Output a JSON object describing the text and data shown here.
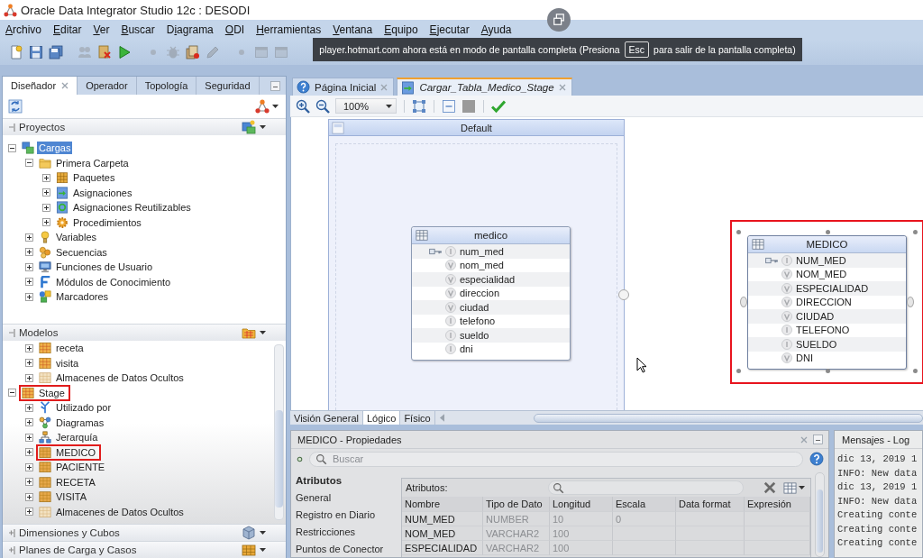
{
  "window": {
    "title": "Oracle Data Integrator Studio 12c : DESODI"
  },
  "menu": [
    {
      "mnemonic": "A",
      "rest": "rchivo"
    },
    {
      "mnemonic": "E",
      "rest": "ditar"
    },
    {
      "mnemonic": "V",
      "rest": "er"
    },
    {
      "mnemonic": "B",
      "rest": "uscar"
    },
    {
      "lead": "D",
      "mnemonic": "i",
      "rest": "agrama"
    },
    {
      "mnemonic": "O",
      "rest": "DI"
    },
    {
      "mnemonic": "H",
      "rest": "erramientas"
    },
    {
      "mnemonic": "V",
      "rest": "entana"
    },
    {
      "mnemonic": "E",
      "rest": "quipo"
    },
    {
      "mnemonic": "E",
      "rest": "jecutar"
    },
    {
      "mnemonic": "A",
      "rest": "yuda"
    }
  ],
  "toolbar": [
    {
      "buttons": [
        {
          "kind": "new",
          "disabled": false
        },
        {
          "kind": "save",
          "disabled": false
        },
        {
          "kind": "save-all",
          "disabled": false
        }
      ]
    },
    {
      "buttons": [
        {
          "kind": "users",
          "disabled": true
        },
        {
          "kind": "delete",
          "disabled": false
        },
        {
          "kind": "run",
          "disabled": false
        }
      ]
    },
    {
      "buttons": [
        {
          "kind": "dot",
          "disabled": true
        },
        {
          "kind": "bug",
          "disabled": true
        },
        {
          "kind": "stack",
          "disabled": false
        },
        {
          "kind": "edit",
          "disabled": true
        }
      ]
    },
    {
      "buttons": [
        {
          "kind": "dot",
          "disabled": true
        },
        {
          "kind": "window",
          "disabled": true
        },
        {
          "kind": "window",
          "disabled": true
        }
      ]
    }
  ],
  "fullscreen_notice": {
    "message_start": "player.hotmart.com ahora está en modo de pantalla completa (Presiona",
    "key": "Esc",
    "message_end": "para salir de la pantalla completa)"
  },
  "left_panel": {
    "tabs": [
      {
        "label": "Diseñador",
        "selected": true,
        "closable": true
      },
      {
        "label": "Operador",
        "selected": false,
        "closable": false
      },
      {
        "label": "Topología",
        "selected": false,
        "closable": false
      },
      {
        "label": "Seguridad",
        "selected": false,
        "closable": false
      }
    ],
    "sections": [
      {
        "kind": "projects",
        "title": "Proyectos",
        "expanded": true,
        "tree": [
          {
            "label": "Cargas",
            "kind": "project",
            "expanded": true,
            "selected": true,
            "children": [
              {
                "label": "Primera Carpeta",
                "kind": "folder",
                "expanded": true,
                "selected": false,
                "children": [
                  {
                    "label": "Paquetes",
                    "kind": "package",
                    "expanded": false,
                    "selected": false
                  },
                  {
                    "label": "Asignaciones",
                    "kind": "mapping",
                    "expanded": false,
                    "selected": false
                  },
                  {
                    "label": "Asignaciones Reutilizables",
                    "kind": "reusable-mapping",
                    "expanded": false,
                    "selected": false
                  },
                  {
                    "label": "Procedimientos",
                    "kind": "procedure",
                    "expanded": false,
                    "selected": false
                  }
                ]
              },
              {
                "label": "Variables",
                "kind": "variable",
                "expanded": false,
                "selected": false
              },
              {
                "label": "Secuencias",
                "kind": "sequence",
                "expanded": false,
                "selected": false
              },
              {
                "label": "Funciones de Usuario",
                "kind": "user-function",
                "expanded": false,
                "selected": false
              },
              {
                "label": "Módulos de Conocimiento",
                "kind": "knowledge-module",
                "expanded": false,
                "selected": false
              },
              {
                "label": "Marcadores",
                "kind": "marker",
                "expanded": false,
                "selected": false
              }
            ]
          }
        ]
      },
      {
        "kind": "models",
        "title": "Modelos",
        "expanded": true,
        "tree": [
          {
            "children": [
              {
                "label": "receta",
                "kind": "model",
                "expanded": false,
                "selected": false,
                "highlighted": false
              },
              {
                "label": "visita",
                "kind": "model",
                "expanded": false,
                "selected": false,
                "highlighted": false
              },
              {
                "label": "Almacenes de Datos Ocultos",
                "kind": "hidden-datastores",
                "expanded": false,
                "selected": false,
                "highlighted": false
              }
            ]
          },
          {
            "label": "Stage",
            "kind": "model",
            "expanded": true,
            "selected": false,
            "highlighted": true,
            "children": [
              {
                "label": "Utilizado por",
                "kind": "used-by",
                "expanded": false,
                "selected": false,
                "highlighted": false
              },
              {
                "label": "Diagramas",
                "kind": "diagram",
                "expanded": false,
                "selected": false,
                "highlighted": false
              },
              {
                "label": "Jerarquía",
                "kind": "hierarchy",
                "expanded": false,
                "selected": false,
                "highlighted": false
              },
              {
                "label": "MEDICO",
                "kind": "datastore",
                "expanded": false,
                "selected": false,
                "highlighted": true
              },
              {
                "label": "PACIENTE",
                "kind": "datastore",
                "expanded": false,
                "selected": false,
                "highlighted": false
              },
              {
                "label": "RECETA",
                "kind": "datastore",
                "expanded": false,
                "selected": false,
                "highlighted": false
              },
              {
                "label": "VISITA",
                "kind": "datastore",
                "expanded": false,
                "selected": false,
                "highlighted": false
              },
              {
                "label": "Almacenes de Datos Ocultos",
                "kind": "hidden-datastores",
                "expanded": false,
                "selected": false,
                "highlighted": false
              }
            ]
          }
        ]
      },
      {
        "kind": "dimensions",
        "title": "Dimensiones y Cubos",
        "expanded": false
      },
      {
        "kind": "load-plans",
        "title": "Planes de Carga y Casos",
        "expanded": false
      }
    ]
  },
  "editor": {
    "tabs": [
      {
        "label": "Página Inicial",
        "kind": "start-page",
        "selected": false
      },
      {
        "label": "Cargar_Tabla_Medico_Stage",
        "kind": "mapping",
        "selected": true
      }
    ],
    "zoom": "100%",
    "diagram": {
      "group": {
        "title": "Default"
      },
      "entities": [
        {
          "name": "medico",
          "selected": false,
          "highlighted": false,
          "columns": [
            {
              "name": "num_med",
              "kind": "number",
              "primary_key": true
            },
            {
              "name": "nom_med",
              "kind": "varchar",
              "primary_key": false
            },
            {
              "name": "especialidad",
              "kind": "varchar",
              "primary_key": false
            },
            {
              "name": "direccion",
              "kind": "varchar",
              "primary_key": false
            },
            {
              "name": "ciudad",
              "kind": "varchar",
              "primary_key": false
            },
            {
              "name": "telefono",
              "kind": "number",
              "primary_key": false
            },
            {
              "name": "sueldo",
              "kind": "number",
              "primary_key": false
            },
            {
              "name": "dni",
              "kind": "number",
              "primary_key": false
            }
          ]
        },
        {
          "name": "MEDICO",
          "selected": true,
          "highlighted": true,
          "columns": [
            {
              "name": "NUM_MED",
              "kind": "number",
              "primary_key": true
            },
            {
              "name": "NOM_MED",
              "kind": "varchar",
              "primary_key": false
            },
            {
              "name": "ESPECIALIDAD",
              "kind": "varchar",
              "primary_key": false
            },
            {
              "name": "DIRECCION",
              "kind": "varchar",
              "primary_key": false
            },
            {
              "name": "CIUDAD",
              "kind": "varchar",
              "primary_key": false
            },
            {
              "name": "TELEFONO",
              "kind": "number",
              "primary_key": false
            },
            {
              "name": "SUELDO",
              "kind": "number",
              "primary_key": false
            },
            {
              "name": "DNI",
              "kind": "varchar",
              "primary_key": false
            }
          ]
        }
      ]
    },
    "view_tabs": [
      {
        "label": "Visión General",
        "selected": false
      },
      {
        "label": "Lógico",
        "selected": true
      },
      {
        "label": "Físico",
        "selected": false
      }
    ]
  },
  "properties": {
    "title": "MEDICO - Propiedades",
    "search": {
      "placeholder": "Buscar"
    },
    "nav": [
      {
        "label": "Atributos",
        "selected": true
      },
      {
        "label": "General",
        "selected": false
      },
      {
        "label": "Registro en Diario",
        "selected": false
      },
      {
        "label": "Restricciones",
        "selected": false
      },
      {
        "label": "Puntos de Conector",
        "selected": false
      }
    ],
    "attributes": {
      "label": "Atributos:",
      "columns": [
        "Nombre",
        "Tipo de Dato",
        "Longitud",
        "Escala",
        "Data format",
        "Expresión"
      ],
      "rows": [
        [
          "NUM_MED",
          "NUMBER",
          "10",
          "0"
        ],
        [
          "NOM_MED",
          "VARCHAR2",
          "100"
        ],
        [
          "ESPECIALIDAD",
          "VARCHAR2",
          "100"
        ]
      ]
    }
  },
  "log": {
    "title": "Mensajes - Log",
    "lines": [
      "dic 13, 2019 1",
      "INFO: New data",
      "dic 13, 2019 1",
      "INFO: New data",
      "Creating conte",
      "Creating conte",
      "Creating conte"
    ]
  }
}
